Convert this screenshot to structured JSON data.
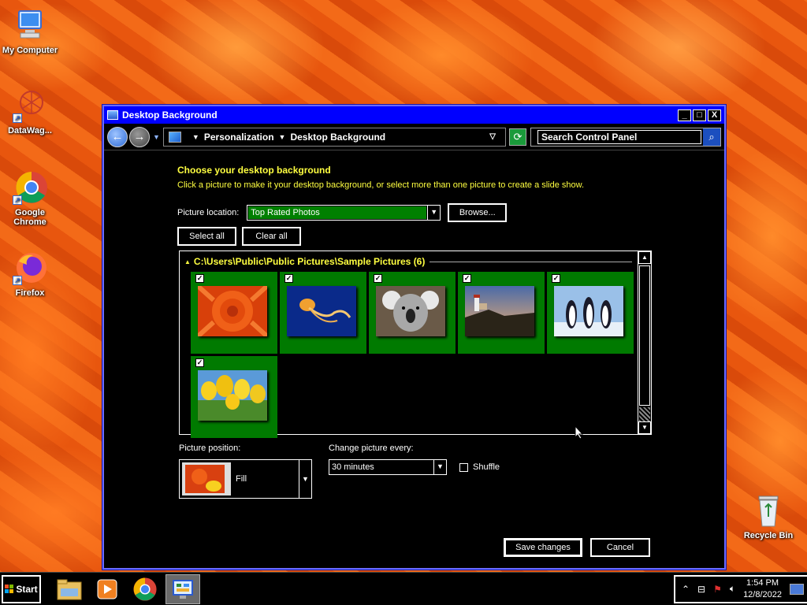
{
  "desktop": {
    "icons": [
      {
        "label": "My Computer",
        "icon": "computer-icon"
      },
      {
        "label": "DataWag...",
        "icon": "datawag-icon"
      },
      {
        "label": "Google Chrome",
        "icon": "chrome-icon"
      },
      {
        "label": "Firefox",
        "icon": "firefox-icon"
      },
      {
        "label": "Recycle Bin",
        "icon": "recycle-bin-icon"
      }
    ]
  },
  "window": {
    "title": "Desktop Background",
    "controls": {
      "minimize": "_",
      "maximize": "□",
      "close": "X"
    },
    "breadcrumb": [
      "Personalization",
      "Desktop Background"
    ],
    "search_placeholder": "Search Control Panel"
  },
  "content": {
    "heading": "Choose your desktop background",
    "instructions": "Click a picture to make it your desktop background, or select more than one picture to create a slide show.",
    "picture_location_label": "Picture location:",
    "picture_location_value": "Top Rated Photos",
    "browse_label": "Browse...",
    "select_all_label": "Select all",
    "clear_all_label": "Clear all",
    "group_title": "C:\\Users\\Public\\Public Pictures\\Sample Pictures (6)",
    "pictures": [
      {
        "name": "chrysanthemum",
        "checked": true
      },
      {
        "name": "jellyfish",
        "checked": true
      },
      {
        "name": "koala",
        "checked": true
      },
      {
        "name": "lighthouse",
        "checked": true
      },
      {
        "name": "penguins",
        "checked": true
      },
      {
        "name": "tulips",
        "checked": true
      }
    ],
    "picture_position_label": "Picture position:",
    "picture_position_value": "Fill",
    "change_every_label": "Change picture every:",
    "change_every_value": "30 minutes",
    "shuffle_label": "Shuffle",
    "shuffle_checked": false,
    "save_label": "Save changes",
    "cancel_label": "Cancel"
  },
  "taskbar": {
    "start_label": "Start",
    "apps": [
      "file-explorer-icon",
      "media-player-icon",
      "chrome-icon",
      "control-panel-icon"
    ],
    "time": "1:54 PM",
    "date": "12/8/2022"
  },
  "colors": {
    "accent_yellow": "#ffff40",
    "titlebar_blue": "#0000ff",
    "selection_green": "#008000"
  }
}
